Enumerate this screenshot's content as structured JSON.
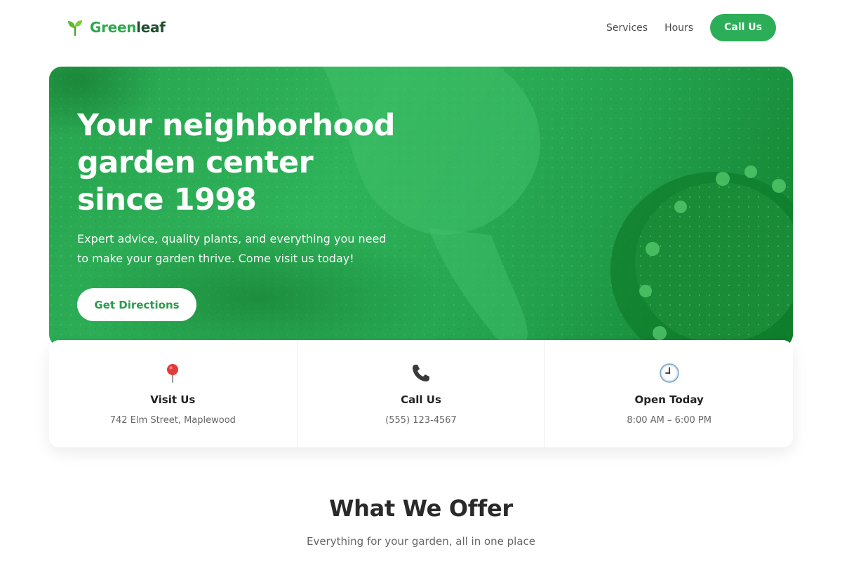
{
  "header": {
    "logo_part1": "Green",
    "logo_part2": "leaf",
    "nav": [
      {
        "label": "Services"
      },
      {
        "label": "Hours"
      }
    ],
    "cta_label": "Call Us"
  },
  "hero": {
    "title_line1": "Your neighborhood",
    "title_line2": "garden center",
    "title_line3": "since 1998",
    "subtitle": "Expert advice, quality plants, and everything you need to make your garden thrive. Come visit us today!",
    "button_label": "Get Directions"
  },
  "info": [
    {
      "icon": "map-pin-icon",
      "title": "Visit Us",
      "text": "742 Elm Street, Maplewood"
    },
    {
      "icon": "phone-icon",
      "title": "Call Us",
      "text": "(555) 123-4567"
    },
    {
      "icon": "clock-icon",
      "title": "Open Today",
      "text": "8:00 AM – 6:00 PM"
    }
  ],
  "offer": {
    "title": "What We Offer",
    "subtitle": "Everything for your garden, all in one place"
  },
  "colors": {
    "brand_green": "#2cae58",
    "hero_green": "#2eb35a",
    "text_dark": "#2a2a2a"
  }
}
